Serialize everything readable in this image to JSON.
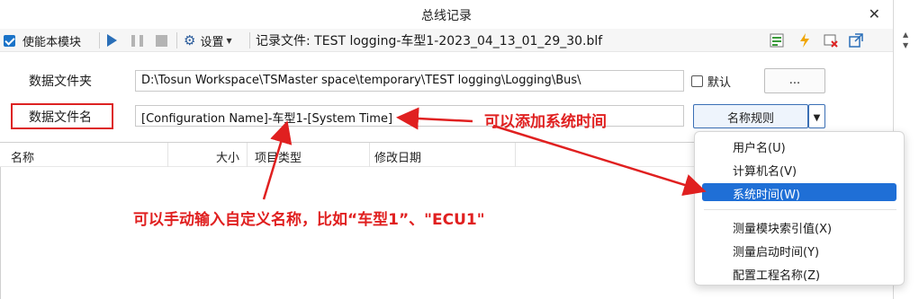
{
  "window": {
    "title": "总线记录",
    "close_glyph": "✕"
  },
  "toolbar": {
    "enable_label": "使能本模块",
    "settings_label": "设置",
    "file_label": "记录文件: TEST logging-车型1-2023_04_13_01_29_30.blf"
  },
  "form": {
    "folder_label": "数据文件夹",
    "folder_value": "D:\\Tosun Workspace\\TSMaster space\\temporary\\TEST logging\\Logging\\Bus\\",
    "default_label": "默认",
    "browse_label": "...",
    "filename_label": "数据文件名",
    "filename_value": "[Configuration Name]-车型1-[System Time]",
    "naming_rule_label": "名称规则"
  },
  "list": {
    "columns": [
      "名称",
      "大小",
      "项目类型",
      "修改日期"
    ]
  },
  "menu": {
    "items": [
      {
        "label": "用户名(U)",
        "selected": false
      },
      {
        "label": "计算机名(V)",
        "selected": false
      },
      {
        "label": "系统时间(W)",
        "selected": true
      },
      {
        "label": "测量模块索引值(X)",
        "selected": false
      },
      {
        "label": "测量启动时间(Y)",
        "selected": false
      },
      {
        "label": "配置工程名称(Z)",
        "selected": false
      }
    ]
  },
  "annotations": {
    "add_time": "可以添加系统时间",
    "manual_name": "可以手动输入自定义名称，比如“车型1”、\"ECU1\""
  },
  "colors": {
    "accent": "#1f6fd6",
    "annotation": "#e02020",
    "checkbox": "#1a73c8"
  },
  "icons": [
    "play-icon",
    "pause-icon",
    "stop-icon",
    "gear-icon",
    "chevron-down-icon",
    "export-icon",
    "lightning-icon",
    "clear-icon",
    "open-external-icon"
  ]
}
